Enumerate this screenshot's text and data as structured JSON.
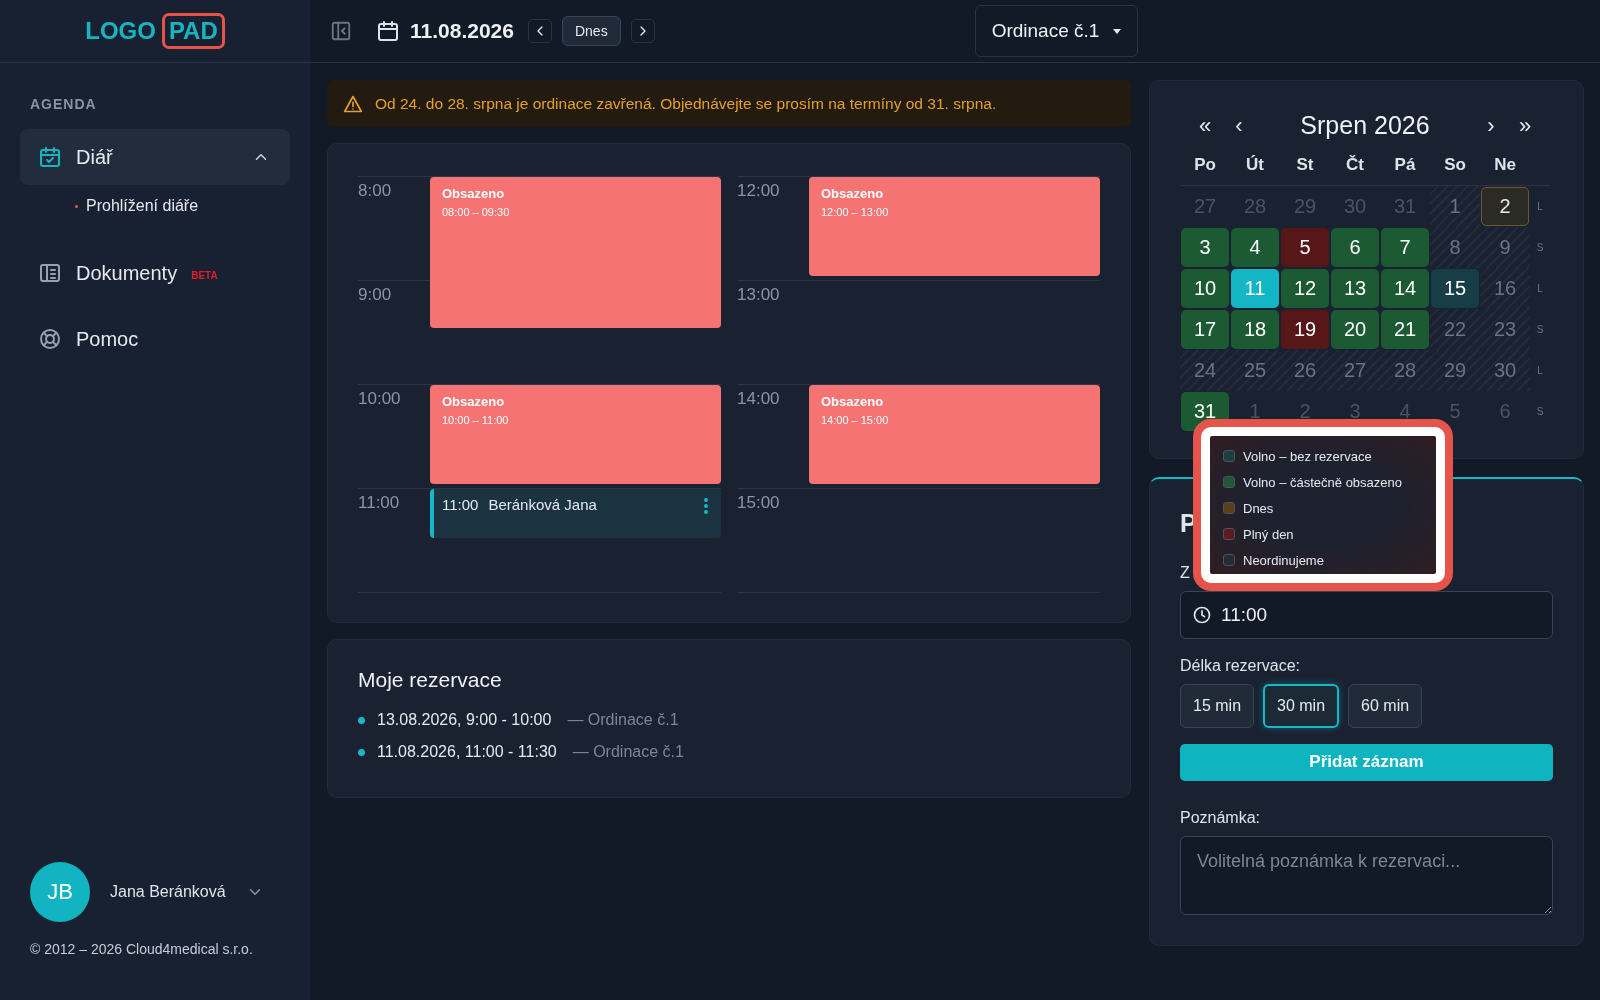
{
  "logo": {
    "text": "LOGO",
    "boxed": "PAD"
  },
  "sidebar": {
    "section": "AGENDA",
    "items": [
      {
        "label": "Diář",
        "selected": true,
        "expanded": true,
        "children": [
          {
            "label": "Prohlížení diáře",
            "selected": true
          }
        ]
      },
      {
        "label": "Dokumenty",
        "selected": false,
        "badge": "BETA"
      },
      {
        "label": "Pomoc",
        "selected": false
      }
    ],
    "user": {
      "initials": "JB",
      "name": "Jana Beránková"
    },
    "footer": "© 2012 – 2026 Cloud4medical s.r.o."
  },
  "header": {
    "date": "11.08.2026",
    "today_button": "Dnes",
    "location": "Ordinace č.1"
  },
  "alert": "Od 24. do 28. srpna je ordinace zavřená. Objednávejte se prosím na termíny od 31. srpna.",
  "schedule": {
    "columns": [
      {
        "hours": [
          {
            "label": "8:00",
            "events": [
              {
                "kind": "busy",
                "title": "Obsazeno",
                "time": "08:00 – 09:30"
              }
            ]
          },
          {
            "label": "9:00"
          },
          {
            "label": "10:00",
            "events": [
              {
                "kind": "busy",
                "title": "Obsazeno",
                "time": "10:00 – 11:00"
              }
            ]
          },
          {
            "label": "11:00",
            "events": [
              {
                "kind": "mine",
                "time": "11:00",
                "title": "Beránková Jana"
              }
            ]
          }
        ]
      },
      {
        "hours": [
          {
            "label": "12:00",
            "events": [
              {
                "kind": "busy",
                "title": "Obsazeno",
                "time": "12:00 – 13:00"
              }
            ]
          },
          {
            "label": "13:00"
          },
          {
            "label": "14:00",
            "events": [
              {
                "kind": "busy",
                "title": "Obsazeno",
                "time": "14:00 – 15:00"
              }
            ]
          },
          {
            "label": "15:00"
          }
        ]
      }
    ]
  },
  "reservations": {
    "title": "Moje rezervace",
    "items": [
      {
        "when": "13.08.2026, 9:00 - 10:00",
        "place": "— Ordinace č.1"
      },
      {
        "when": "11.08.2026, 11:00 - 11:30",
        "place": "— Ordinace č.1"
      }
    ]
  },
  "calendar": {
    "title": "Srpen 2026",
    "nav": [
      "«",
      "‹",
      "›",
      "»"
    ],
    "weekdays": [
      "Po",
      "Út",
      "St",
      "Čt",
      "Pá",
      "So",
      "Ne"
    ],
    "weeks": [
      {
        "parity": "L",
        "days": [
          {
            "label": "27",
            "kind": "outside",
            "selected": false
          },
          {
            "label": "28",
            "kind": "outside",
            "selected": false
          },
          {
            "label": "29",
            "kind": "outside",
            "selected": false
          },
          {
            "label": "30",
            "kind": "outside",
            "selected": false
          },
          {
            "label": "31",
            "kind": "outside",
            "selected": false
          },
          {
            "label": "1",
            "kind": "closed",
            "selected": false
          },
          {
            "label": "2",
            "kind": "today",
            "selected": false
          }
        ]
      },
      {
        "parity": "S",
        "days": [
          {
            "label": "3",
            "kind": "partial",
            "selected": false
          },
          {
            "label": "4",
            "kind": "partial",
            "selected": false
          },
          {
            "label": "5",
            "kind": "full",
            "selected": false
          },
          {
            "label": "6",
            "kind": "partial",
            "selected": false
          },
          {
            "label": "7",
            "kind": "partial",
            "selected": false
          },
          {
            "label": "8",
            "kind": "closed",
            "selected": false
          },
          {
            "label": "9",
            "kind": "closed",
            "selected": false
          }
        ]
      },
      {
        "parity": "L",
        "days": [
          {
            "label": "10",
            "kind": "partial",
            "selected": false
          },
          {
            "label": "11",
            "kind": "partial",
            "selected": true
          },
          {
            "label": "12",
            "kind": "partial",
            "selected": false
          },
          {
            "label": "13",
            "kind": "partial",
            "selected": false
          },
          {
            "label": "14",
            "kind": "partial",
            "selected": false
          },
          {
            "label": "15",
            "kind": "free",
            "selected": false
          },
          {
            "label": "16",
            "kind": "closed",
            "selected": false
          }
        ]
      },
      {
        "parity": "S",
        "days": [
          {
            "label": "17",
            "kind": "partial",
            "selected": false
          },
          {
            "label": "18",
            "kind": "partial",
            "selected": false
          },
          {
            "label": "19",
            "kind": "full",
            "selected": false
          },
          {
            "label": "20",
            "kind": "partial",
            "selected": false
          },
          {
            "label": "21",
            "kind": "partial",
            "selected": false
          },
          {
            "label": "22",
            "kind": "closed",
            "selected": false
          },
          {
            "label": "23",
            "kind": "closed",
            "selected": false
          }
        ]
      },
      {
        "parity": "L",
        "days": [
          {
            "label": "24",
            "kind": "closed",
            "selected": false
          },
          {
            "label": "25",
            "kind": "closed",
            "selected": false
          },
          {
            "label": "26",
            "kind": "closed",
            "selected": false
          },
          {
            "label": "27",
            "kind": "closed",
            "selected": false
          },
          {
            "label": "28",
            "kind": "closed",
            "selected": false
          },
          {
            "label": "29",
            "kind": "closed",
            "selected": false
          },
          {
            "label": "30",
            "kind": "closed",
            "selected": false
          }
        ]
      },
      {
        "parity": "S",
        "days": [
          {
            "label": "31",
            "kind": "partial",
            "selected": false
          },
          {
            "label": "1",
            "kind": "outside",
            "selected": false
          },
          {
            "label": "2",
            "kind": "outside",
            "selected": false
          },
          {
            "label": "3",
            "kind": "outside",
            "selected": false
          },
          {
            "label": "4",
            "kind": "outside",
            "selected": false
          },
          {
            "label": "5",
            "kind": "outside",
            "selected": false
          },
          {
            "label": "6",
            "kind": "outside",
            "selected": false
          }
        ]
      }
    ]
  },
  "legend": {
    "items": [
      {
        "label": "Volno – bez rezervace",
        "color": "#1d3f42"
      },
      {
        "label": "Volno – částečně obsazeno",
        "color": "#1d5a33"
      },
      {
        "label": "Dnes",
        "color": "#5a3e16"
      },
      {
        "label": "Plný den",
        "color": "#5e1a1c"
      },
      {
        "label": "Neordinujeme",
        "color": "#262a33"
      }
    ]
  },
  "form": {
    "title": "P",
    "time_label": "Z",
    "time": "11:00",
    "duration_label": "Délka rezervace:",
    "durations": [
      {
        "label": "15 min",
        "selected": false
      },
      {
        "label": "30 min",
        "selected": true
      },
      {
        "label": "60 min",
        "selected": false
      }
    ],
    "submit": "Přidat záznam",
    "note_label": "Poznámka:",
    "note_placeholder": "Volitelná poznámka k rezervaci..."
  }
}
